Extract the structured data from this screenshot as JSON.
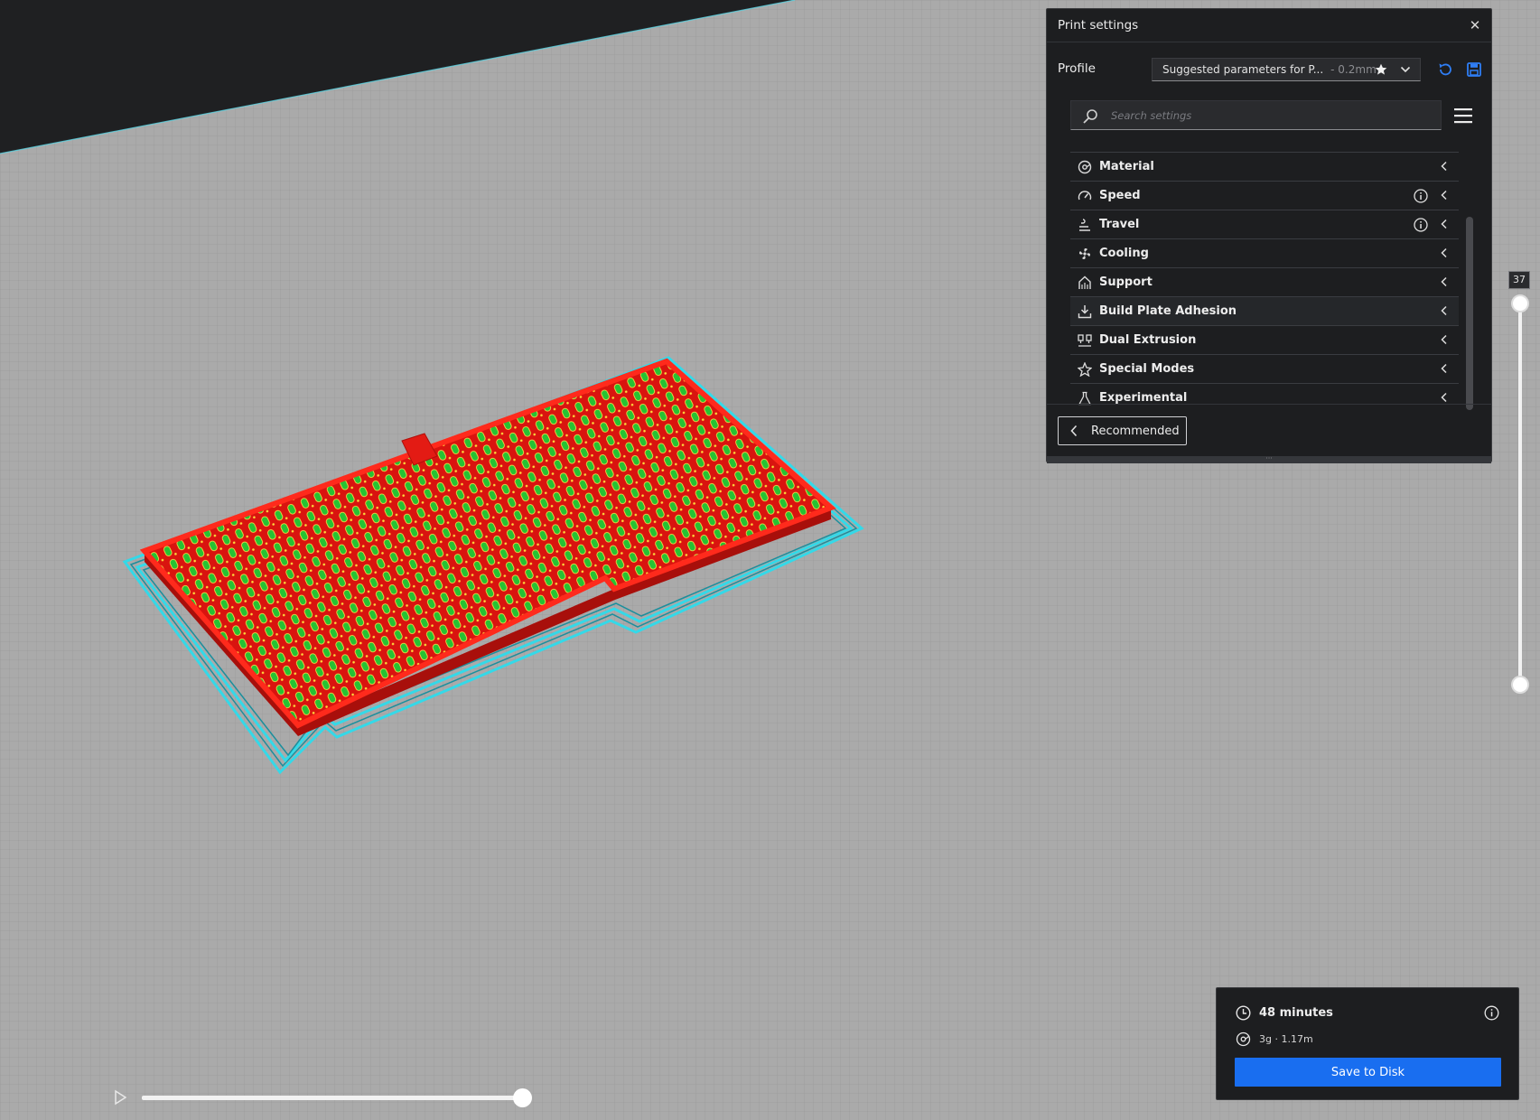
{
  "print_settings": {
    "title": "Print settings",
    "profile_label": "Profile",
    "profile_name": "Suggested parameters for P...",
    "profile_layer": "- 0.2mm",
    "search_placeholder": "Search settings",
    "categories": [
      {
        "label": "Material",
        "icon": "material-icon",
        "info": false
      },
      {
        "label": "Speed",
        "icon": "speed-icon",
        "info": true
      },
      {
        "label": "Travel",
        "icon": "travel-icon",
        "info": true
      },
      {
        "label": "Cooling",
        "icon": "cooling-fan-icon",
        "info": false
      },
      {
        "label": "Support",
        "icon": "support-icon",
        "info": false
      },
      {
        "label": "Build Plate Adhesion",
        "icon": "adhesion-icon",
        "info": false
      },
      {
        "label": "Dual Extrusion",
        "icon": "dual-extrusion-icon",
        "info": false
      },
      {
        "label": "Special Modes",
        "icon": "special-modes-star-icon",
        "info": false
      },
      {
        "label": "Experimental",
        "icon": "experimental-flask-icon",
        "info": false
      }
    ],
    "recommended_label": "Recommended"
  },
  "layer_slider": {
    "current_layer": "37"
  },
  "simulation": {
    "progress": 1.0
  },
  "estimate": {
    "time": "48 minutes",
    "material": "3g · 1.17m",
    "save_label": "Save to Disk"
  },
  "colors": {
    "accent": "#196ef0",
    "panel": "#1d1e20",
    "plate": "#a9a9a9",
    "model_wall": "#e31b14",
    "infill": "#2ed13a",
    "skirt": "#34d9e8"
  }
}
